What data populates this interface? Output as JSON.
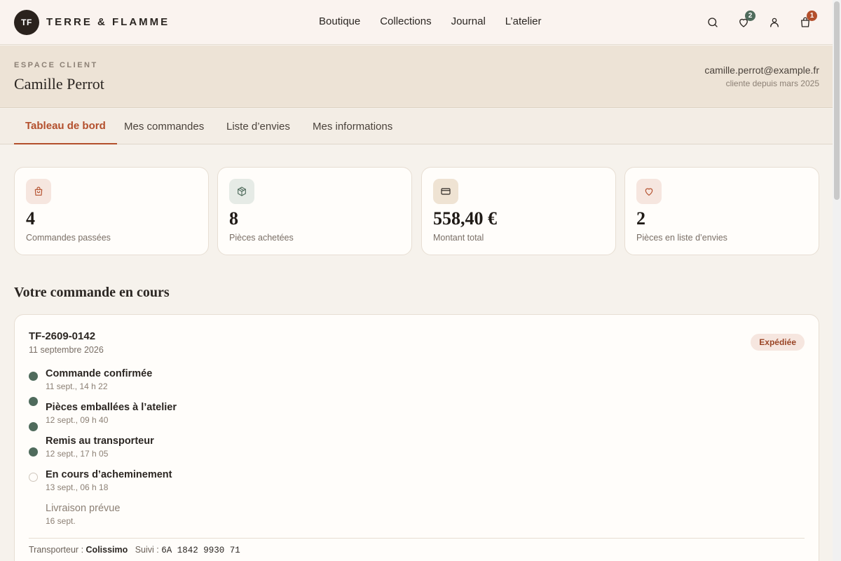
{
  "header": {
    "logo_initials": "TF",
    "brand": "TERRE & FLAMME",
    "nav": [
      "Boutique",
      "Collections",
      "Journal",
      "L’atelier"
    ],
    "wishlist_count": "2",
    "cart_count": "1",
    "icons": [
      "search-icon",
      "heart-icon",
      "user-icon",
      "bag-icon"
    ]
  },
  "account": {
    "eyebrow": "ESPACE CLIENT",
    "name": "Camille Perrot",
    "email": "camille.perrot@example.fr",
    "since": "cliente depuis mars 2025"
  },
  "tabs": [
    {
      "label": "Tableau de bord",
      "active": true
    },
    {
      "label": "Mes commandes",
      "active": false
    },
    {
      "label": "Liste d’envies",
      "active": false
    },
    {
      "label": "Mes informations",
      "active": false
    }
  ],
  "stats": [
    {
      "value": "4",
      "label": "Commandes passées",
      "icon": "bag-icon"
    },
    {
      "value": "8",
      "label": "Pièces achetées",
      "icon": "box-icon"
    },
    {
      "value": "558,40 €",
      "label": "Montant total",
      "icon": "card-icon"
    },
    {
      "value": "2",
      "label": "Pièces en liste d’envies",
      "icon": "heart-icon"
    }
  ],
  "order": {
    "section_title": "Votre commande en cours",
    "id": "TF-2609-0142",
    "date": "11 septembre 2026",
    "status": "Expédiée",
    "steps": [
      {
        "title": "Commande confirmée",
        "time": "11 sept., 14 h 22",
        "done": true
      },
      {
        "title": "Pièces emballées à l’atelier",
        "time": "12 sept., 09 h 40",
        "done": true
      },
      {
        "title": "Remis au transporteur",
        "time": "12 sept., 17 h 05",
        "done": true
      },
      {
        "title": "En cours d’acheminement",
        "time": "13 sept., 06 h 18",
        "done": false
      },
      {
        "title": "Livraison prévue",
        "time": "16 sept.",
        "done": false
      }
    ],
    "carrier_label": "Transporteur :",
    "carrier": "Colissimo",
    "tracking_label": "Suivi :",
    "tracking": "6A 1842 9930 71"
  },
  "colors": {
    "accent": "#b34f2c",
    "done": "#4f6b5c",
    "wishlist_badge": "#4f6b5c",
    "cart_badge": "#b34f2c"
  }
}
